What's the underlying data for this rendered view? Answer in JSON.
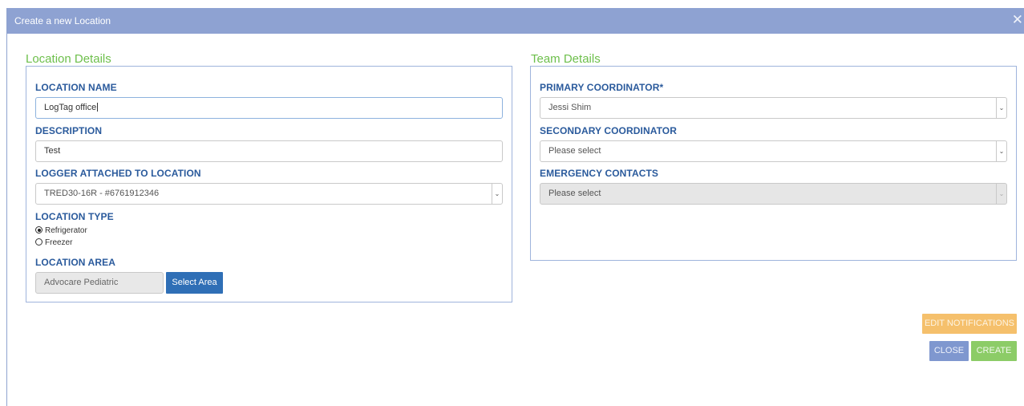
{
  "dialog": {
    "title": "Create a new Location",
    "close_glyph": "✕"
  },
  "location_details": {
    "heading": "Location Details",
    "name_label": "LOCATION NAME",
    "name_value": "LogTag office",
    "description_label": "DESCRIPTION",
    "description_value": "Test",
    "logger_label": "LOGGER ATTACHED TO LOCATION",
    "logger_value": "TRED30-16R - #6761912346",
    "type_label": "LOCATION TYPE",
    "type_options": [
      {
        "label": "Refrigerator",
        "checked": true
      },
      {
        "label": "Freezer",
        "checked": false
      }
    ],
    "area_label": "LOCATION AREA",
    "area_value": "Advocare Pediatric",
    "select_area_button": "Select Area"
  },
  "team_details": {
    "heading": "Team Details",
    "primary_label": "PRIMARY COORDINATOR*",
    "primary_value": "Jessi Shim",
    "secondary_label": "SECONDARY COORDINATOR",
    "secondary_value": "Please select",
    "emergency_label": "EMERGENCY CONTACTS",
    "emergency_value": "Please select"
  },
  "footer": {
    "edit_notifications": "EDIT NOTIFICATIONS",
    "close": "CLOSE",
    "create": "CREATE"
  },
  "icons": {
    "chevron": "chevron-down-icon",
    "close": "close-icon"
  },
  "colors": {
    "titlebar": "#8ea2d2",
    "section_heading": "#6dbf4b",
    "field_label": "#2a5a9c",
    "select_area_button": "#2f6fb6",
    "edit_notifications_button": "#f5c06c",
    "close_button": "#7f97cf",
    "create_button": "#8ccc67"
  }
}
